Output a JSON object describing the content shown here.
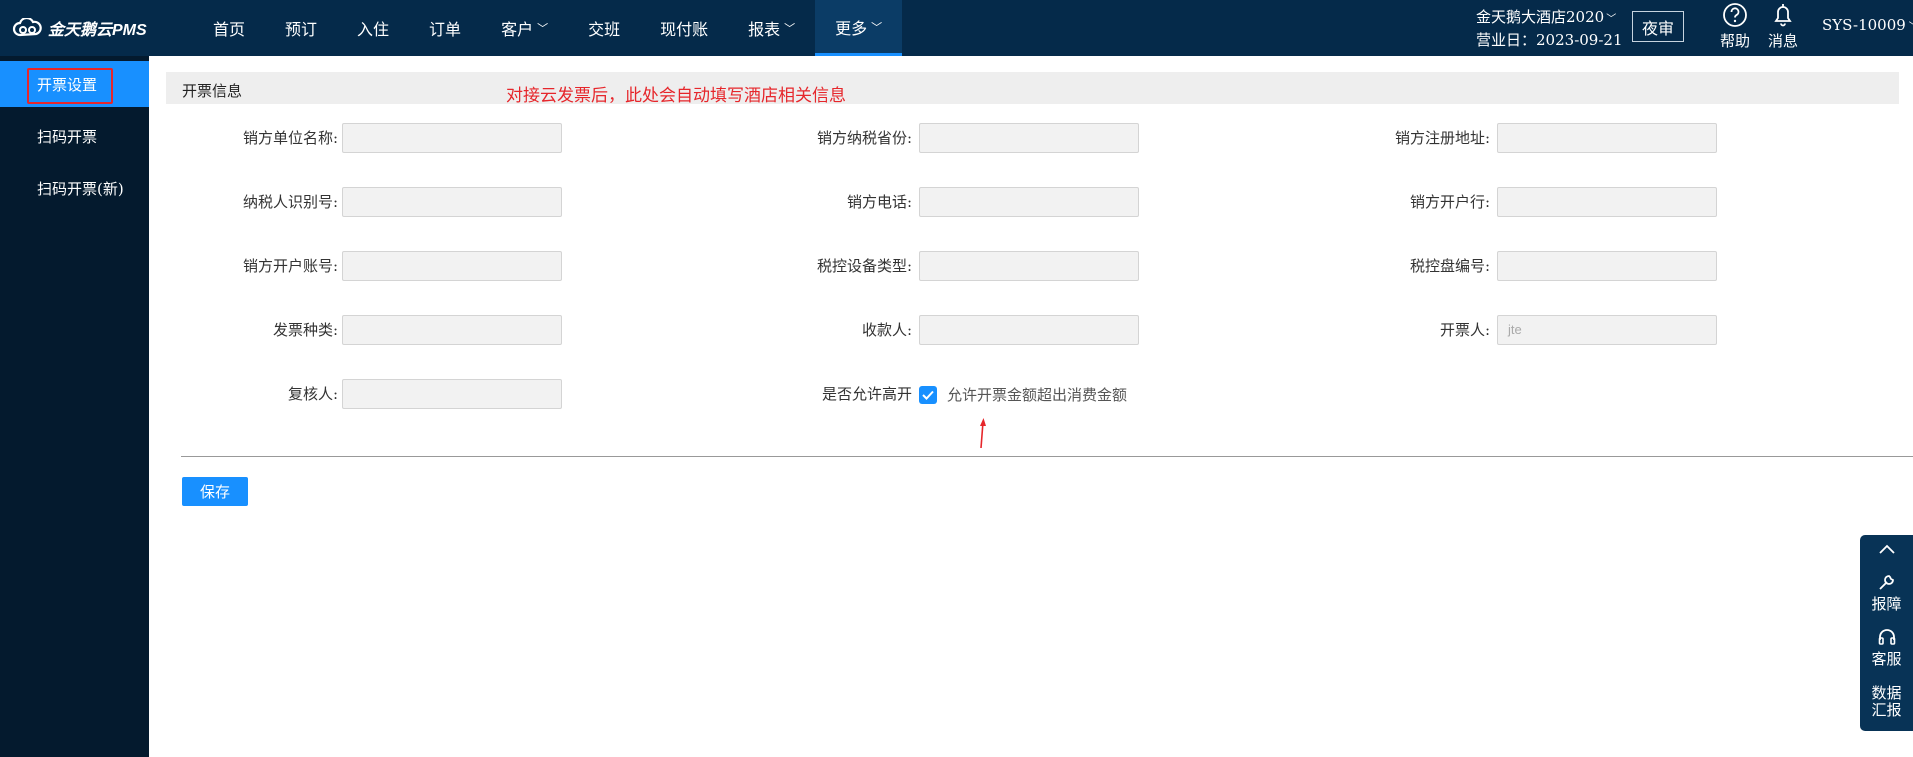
{
  "app": {
    "logo_text": "金天鹅云PMS"
  },
  "nav": {
    "items": [
      {
        "label": "首页",
        "dropdown": false,
        "active": false
      },
      {
        "label": "预订",
        "dropdown": false,
        "active": false
      },
      {
        "label": "入住",
        "dropdown": false,
        "active": false
      },
      {
        "label": "订单",
        "dropdown": false,
        "active": false
      },
      {
        "label": "客户",
        "dropdown": true,
        "active": false
      },
      {
        "label": "交班",
        "dropdown": false,
        "active": false
      },
      {
        "label": "现付账",
        "dropdown": false,
        "active": false
      },
      {
        "label": "报表",
        "dropdown": true,
        "active": false
      },
      {
        "label": "更多",
        "dropdown": true,
        "active": true
      }
    ]
  },
  "header": {
    "hotel_name": "金天鹅大酒店2020",
    "business_date_label": "营业日：",
    "business_date": "2023-09-21",
    "night_audit_label": "夜审",
    "help_label": "帮助",
    "message_label": "消息",
    "user": "SYS-10009"
  },
  "sidebar": {
    "items": [
      {
        "label": "开票设置",
        "active": true
      },
      {
        "label": "扫码开票",
        "active": false
      },
      {
        "label": "扫码开票(新)",
        "active": false
      }
    ]
  },
  "section": {
    "title": "开票信息",
    "annotation": "对接云发票后，此处会自动填写酒店相关信息"
  },
  "form": {
    "fields": [
      {
        "label": "销方单位名称:",
        "value": "",
        "placeholder": ""
      },
      {
        "label": "销方纳税省份:",
        "value": "",
        "placeholder": ""
      },
      {
        "label": "销方注册地址:",
        "value": "",
        "placeholder": ""
      },
      {
        "label": "纳税人识别号:",
        "value": "",
        "placeholder": ""
      },
      {
        "label": "销方电话:",
        "value": "",
        "placeholder": ""
      },
      {
        "label": "销方开户行:",
        "value": "",
        "placeholder": ""
      },
      {
        "label": "销方开户账号:",
        "value": "",
        "placeholder": ""
      },
      {
        "label": "税控设备类型:",
        "value": "",
        "placeholder": ""
      },
      {
        "label": "税控盘编号:",
        "value": "",
        "placeholder": ""
      },
      {
        "label": "发票种类:",
        "value": "",
        "placeholder": ""
      },
      {
        "label": "收款人:",
        "value": "",
        "placeholder": ""
      },
      {
        "label": "开票人:",
        "value": "",
        "placeholder": "jte"
      },
      {
        "label": "复核人:",
        "value": "",
        "placeholder": ""
      }
    ],
    "allow_over_label": "是否允许高开",
    "allow_over_checked": true,
    "allow_over_text": "允许开票金额超出消费金额",
    "save_label": "保存"
  },
  "float_panel": {
    "report_label": "报障",
    "service_label": "客服",
    "data_label_1": "数据",
    "data_label_2": "汇报"
  },
  "colors": {
    "nav_bg": "#052a4a",
    "sidebar_bg": "#041a2e",
    "accent": "#1890ff",
    "annotation": "#e6262b"
  }
}
